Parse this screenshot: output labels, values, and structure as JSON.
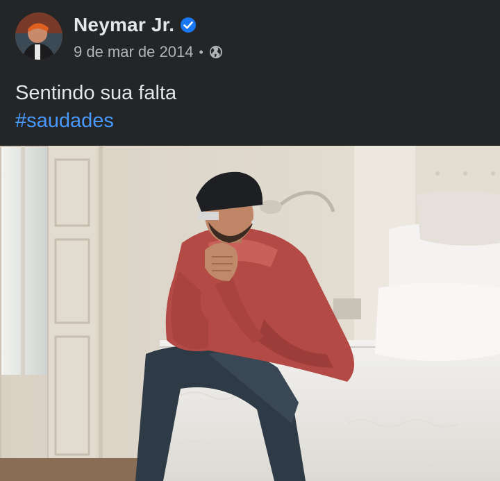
{
  "author": {
    "name": "Neymar Jr.",
    "verified": true,
    "verified_color": "#1877f2"
  },
  "meta": {
    "date": "9 de mar de 2014",
    "separator": "•",
    "audience_icon": "globe-icon"
  },
  "post": {
    "text": "Sentindo sua falta",
    "hashtag": "#saudades",
    "hashtag_color": "#4599ff"
  },
  "colors": {
    "background": "#242526",
    "primary_text": "#e4e6eb",
    "secondary_text": "#b0b3b8"
  }
}
